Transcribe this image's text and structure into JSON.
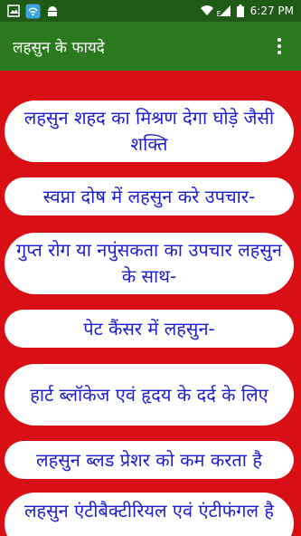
{
  "status_bar": {
    "icons_left": [
      "notification-image-icon",
      "wifi-hotspot-icon",
      "android-icon"
    ],
    "icons_right": [
      "wifi-icon",
      "signal-icon",
      "battery-icon"
    ],
    "network_label": "E",
    "time": "6:27 PM"
  },
  "app_bar": {
    "title": "लहसुन के फायदे",
    "menu_icon": "more-vertical-icon"
  },
  "colors": {
    "status_bar": "#1f5a16",
    "app_bar": "#2b7a20",
    "background": "#d80f14",
    "item_background": "#ffffff",
    "item_text": "#1d1dd6"
  },
  "items": [
    {
      "label": "लहसुन शहद का मिश्रण देगा घोड़े जैसी शक्ति"
    },
    {
      "label": "स्वप्ना दोष में लहसुन करे उपचार-"
    },
    {
      "label": "गुप्त रोग या नपुंसकता का उपचार लहसुन के साथ-"
    },
    {
      "label": "पेट कैंसर में लहसुन-"
    },
    {
      "label": "हार्ट ब्लॉकेज एवं हृदय के दर्द के लिए"
    },
    {
      "label": "लहसुन ब्लड प्रेशर को कम करता है"
    },
    {
      "label": "लहसुन एंटीबैक्टीरियल एवं एंटीफंगल है"
    }
  ]
}
